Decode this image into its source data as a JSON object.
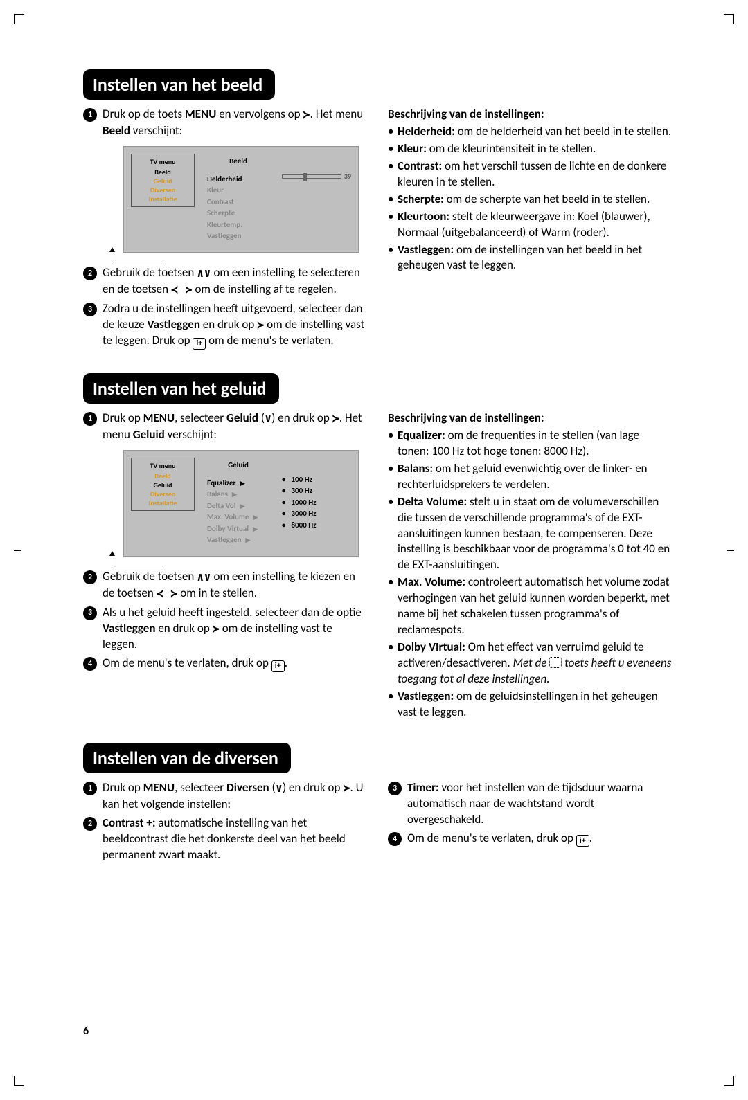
{
  "page_number": "6",
  "sections": {
    "beeld": {
      "title": "Instellen van het beeld",
      "steps": [
        {
          "pre": "Druk op de toets ",
          "b1": "MENU",
          "mid": " en vervolgens op ",
          "sym": ">",
          "post": ". Het menu ",
          "b2": "Beeld",
          "post2": " verschijnt:"
        },
        {
          "text_a": "Gebruik de toetsen ",
          "sym1": "∧∨",
          "text_b": " om een instelling te selecteren en de toetsen ",
          "sym2": "< >",
          "text_c": " om de instelling af te regelen."
        },
        {
          "text_a": "Zodra u de instellingen heeft uitgevoerd, selecteer dan de keuze ",
          "b1": "Vastleggen",
          "text_b": " en druk op ",
          "sym1": ">",
          "text_c": " om de instelling vast te leggen. Druk op ",
          "icon": "i+",
          "text_d": " om de menu's te verlaten."
        }
      ],
      "desc_head": "Beschrijving van de instellingen:",
      "desc": [
        {
          "b": "Helderheid:",
          "t": " om de helderheid van het beeld in te stellen."
        },
        {
          "b": "Kleur:",
          "t": " om de kleurintensiteit in te stellen."
        },
        {
          "b": "Contrast:",
          "t": " om het verschil tussen de lichte en de donkere kleuren in te stellen."
        },
        {
          "b": "Scherpte:",
          "t": " om de scherpte van het beeld in te stellen."
        },
        {
          "b": "Kleurtoon:",
          "t": " stelt de kleurweergave in: Koel (blauwer), Normaal (uitgebalanceerd) of Warm (roder)."
        },
        {
          "b": "Vastleggen:",
          "t": " om de instellingen van het beeld in het geheugen vast te leggen."
        }
      ],
      "menu": {
        "left_title": "TV menu",
        "left_items": [
          "Beeld",
          "Geluid",
          "Diversen",
          "Installatie"
        ],
        "left_selected": 0,
        "mid_title": "Beeld",
        "mid_items": [
          "Helderheid",
          "Kleur",
          "Contrast",
          "Scherpte",
          "Kleurtemp.",
          "Vastleggen"
        ],
        "mid_selected": 0,
        "slider_value": "39"
      }
    },
    "geluid": {
      "title": "Instellen van het geluid",
      "steps": [
        {
          "text_a": "Druk op ",
          "b1": "MENU",
          "text_b": ", selecteer ",
          "b2": "Geluid",
          "text_c": " (",
          "sym1": "∨",
          "text_d": ") en druk op ",
          "sym2": ">",
          "text_e": ". Het menu ",
          "b3": "Geluid",
          "text_f": " verschijnt:"
        },
        {
          "text_a": "Gebruik de toetsen ",
          "sym1": "∧∨",
          "text_b": " om een instelling te kiezen en de toetsen ",
          "sym2": "< >",
          "text_c": " om in te stellen."
        },
        {
          "text_a": "Als u het geluid heeft ingesteld, selecteer dan de optie ",
          "b1": "Vastleggen",
          "text_b": " en druk op ",
          "sym1": ">",
          "text_c": " om de instelling vast te leggen."
        },
        {
          "text_a": "Om de menu's te verlaten, druk op ",
          "icon": "i+",
          "text_b": "."
        }
      ],
      "desc_head": "Beschrijving van de instellingen:",
      "desc": [
        {
          "b": "Equalizer:",
          "t": " om de frequenties in te stellen (van lage tonen: 100 Hz tot hoge tonen: 8000 Hz)."
        },
        {
          "b": "Balans:",
          "t": " om het geluid evenwichtig over de linker- en rechterluidsprekers te verdelen."
        },
        {
          "b": "Delta Volume:",
          "t": " stelt u in staat om de volumeverschillen die tussen de verschillende programma's of de EXT-aansluitingen kunnen bestaan, te compenseren. Deze instelling is beschikbaar voor de programma's 0 tot 40 en de EXT-aansluitingen."
        },
        {
          "b": "Max. Volume:",
          "t": " controleert automatisch het volume zodat verhogingen van het geluid kunnen worden beperkt, met name bij het schakelen tussen programma's of reclamespots."
        },
        {
          "b": "Dolby VIrtual:",
          "t": " Om het effect van verruimd geluid te activeren/desactiveren. ",
          "it": "Met de ",
          "icon": "surround",
          "it2": " toets heeft u eveneens toegang tot al deze instellingen."
        },
        {
          "b": "Vastleggen:",
          "t": " om de geluidsinstellingen in het geheugen vast te leggen."
        }
      ],
      "menu": {
        "left_title": "TV menu",
        "left_items": [
          "Beeld",
          "Geluid",
          "Diversen",
          "Installatie"
        ],
        "left_selected": 1,
        "mid_title": "Geluid",
        "mid_items": [
          "Equalizer",
          "Balans",
          "Delta Vol",
          "Max. Volume",
          "Dolby Virtual",
          "Vastleggen"
        ],
        "mid_selected": 0,
        "right_items": [
          "100 Hz",
          "300 Hz",
          "1000 Hz",
          "3000 Hz",
          "8000 Hz"
        ]
      }
    },
    "diversen": {
      "title": "Instellen van de diversen",
      "left_steps": [
        {
          "n": "1",
          "text_a": "Druk op ",
          "b1": "MENU",
          "text_b": ", selecteer ",
          "b2": "Diversen",
          "text_c": " (",
          "sym1": "∨",
          "text_d": ") en druk op ",
          "sym2": ">",
          "text_e": ". U kan het volgende instellen:"
        },
        {
          "n": "2",
          "b1": "Contrast +:",
          "text_a": " automatische instelling van het beeldcontrast die het donkerste deel van het beeld permanent zwart maakt."
        }
      ],
      "right_steps": [
        {
          "n": "3",
          "b1": "Timer:",
          "text_a": " voor het instellen van de tijdsduur waarna automatisch naar de wachtstand wordt overgeschakeld."
        },
        {
          "n": "4",
          "text_a": "Om de menu's te verlaten, druk op ",
          "icon": "i+",
          "text_b": "."
        }
      ]
    }
  }
}
